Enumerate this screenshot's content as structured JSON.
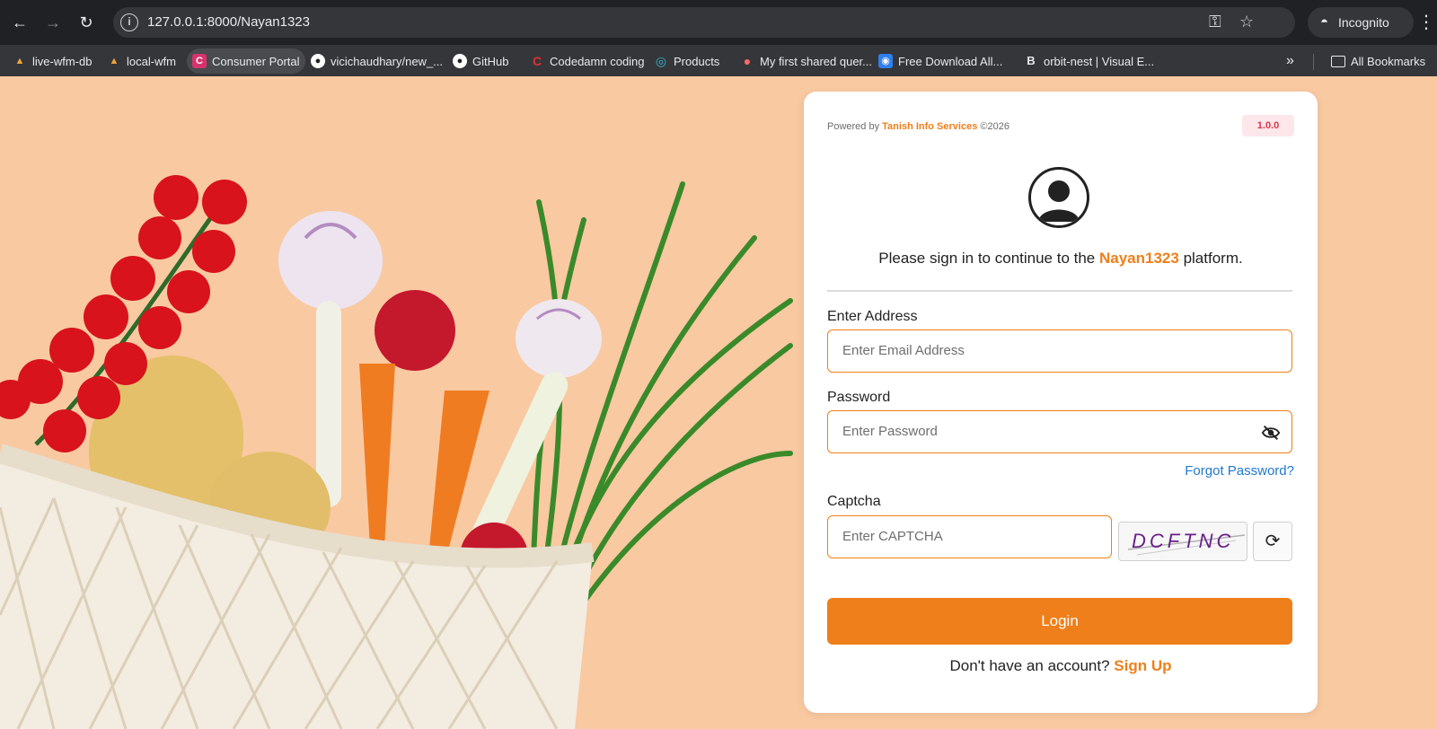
{
  "browser": {
    "url": "127.0.0.1:8000/Nayan1323",
    "incognito_label": "Incognito",
    "all_bookmarks_label": "All Bookmarks",
    "bookmarks": [
      {
        "label": "live-wfm-db",
        "icon": "W",
        "color": "#f0a43c"
      },
      {
        "label": "local-wfm",
        "icon": "W",
        "color": "#f0a43c"
      },
      {
        "label": "Consumer Portal",
        "icon": "C",
        "color": "#d6336c"
      },
      {
        "label": "vicichaudhary/new_...",
        "icon": "G",
        "color": "#ffffff"
      },
      {
        "label": "GitHub",
        "icon": "G",
        "color": "#ffffff"
      },
      {
        "label": "Codedamn coding",
        "icon": "C",
        "color": "#e03131"
      },
      {
        "label": "Products",
        "icon": "P",
        "color": "#33b6c8"
      },
      {
        "label": "My first shared quer...",
        "icon": "M",
        "color": "#ff6b6b"
      },
      {
        "label": "Free Download All...",
        "icon": "F",
        "color": "#2f80ed"
      },
      {
        "label": "orbit-nest | Visual E...",
        "icon": "B",
        "color": "#e8eaed"
      }
    ]
  },
  "login": {
    "powered_prefix": "Powered by",
    "powered_brand": "Tanish Info Services",
    "powered_suffix": "©2026",
    "version": "1.0.0",
    "welcome_prefix": "Please sign in to continue to the",
    "welcome_platform": "Nayan1323",
    "welcome_suffix": "platform.",
    "address_label": "Enter Address",
    "email_placeholder": "Enter Email Address",
    "password_label": "Password",
    "password_placeholder": "Enter Password",
    "forgot_password": "Forgot Password?",
    "captcha_label": "Captcha",
    "captcha_placeholder": "Enter CAPTCHA",
    "captcha_code": "DCFTNC",
    "login_button": "Login",
    "signup_prompt": "Don't have an account?",
    "signup_link": "Sign Up"
  },
  "colors": {
    "accent": "#ef7f1a",
    "link": "#1f78d1",
    "background": "#f9c9a2"
  }
}
